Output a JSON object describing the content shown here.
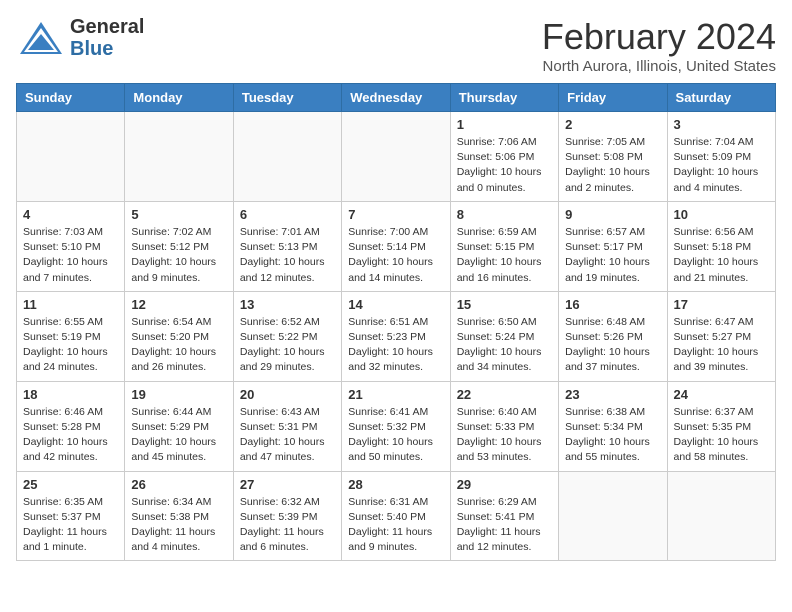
{
  "header": {
    "logo_general": "General",
    "logo_blue": "Blue",
    "month_year": "February 2024",
    "location": "North Aurora, Illinois, United States"
  },
  "weekdays": [
    "Sunday",
    "Monday",
    "Tuesday",
    "Wednesday",
    "Thursday",
    "Friday",
    "Saturday"
  ],
  "weeks": [
    [
      {
        "day": "",
        "info": ""
      },
      {
        "day": "",
        "info": ""
      },
      {
        "day": "",
        "info": ""
      },
      {
        "day": "",
        "info": ""
      },
      {
        "day": "1",
        "info": "Sunrise: 7:06 AM\nSunset: 5:06 PM\nDaylight: 10 hours\nand 0 minutes."
      },
      {
        "day": "2",
        "info": "Sunrise: 7:05 AM\nSunset: 5:08 PM\nDaylight: 10 hours\nand 2 minutes."
      },
      {
        "day": "3",
        "info": "Sunrise: 7:04 AM\nSunset: 5:09 PM\nDaylight: 10 hours\nand 4 minutes."
      }
    ],
    [
      {
        "day": "4",
        "info": "Sunrise: 7:03 AM\nSunset: 5:10 PM\nDaylight: 10 hours\nand 7 minutes."
      },
      {
        "day": "5",
        "info": "Sunrise: 7:02 AM\nSunset: 5:12 PM\nDaylight: 10 hours\nand 9 minutes."
      },
      {
        "day": "6",
        "info": "Sunrise: 7:01 AM\nSunset: 5:13 PM\nDaylight: 10 hours\nand 12 minutes."
      },
      {
        "day": "7",
        "info": "Sunrise: 7:00 AM\nSunset: 5:14 PM\nDaylight: 10 hours\nand 14 minutes."
      },
      {
        "day": "8",
        "info": "Sunrise: 6:59 AM\nSunset: 5:15 PM\nDaylight: 10 hours\nand 16 minutes."
      },
      {
        "day": "9",
        "info": "Sunrise: 6:57 AM\nSunset: 5:17 PM\nDaylight: 10 hours\nand 19 minutes."
      },
      {
        "day": "10",
        "info": "Sunrise: 6:56 AM\nSunset: 5:18 PM\nDaylight: 10 hours\nand 21 minutes."
      }
    ],
    [
      {
        "day": "11",
        "info": "Sunrise: 6:55 AM\nSunset: 5:19 PM\nDaylight: 10 hours\nand 24 minutes."
      },
      {
        "day": "12",
        "info": "Sunrise: 6:54 AM\nSunset: 5:20 PM\nDaylight: 10 hours\nand 26 minutes."
      },
      {
        "day": "13",
        "info": "Sunrise: 6:52 AM\nSunset: 5:22 PM\nDaylight: 10 hours\nand 29 minutes."
      },
      {
        "day": "14",
        "info": "Sunrise: 6:51 AM\nSunset: 5:23 PM\nDaylight: 10 hours\nand 32 minutes."
      },
      {
        "day": "15",
        "info": "Sunrise: 6:50 AM\nSunset: 5:24 PM\nDaylight: 10 hours\nand 34 minutes."
      },
      {
        "day": "16",
        "info": "Sunrise: 6:48 AM\nSunset: 5:26 PM\nDaylight: 10 hours\nand 37 minutes."
      },
      {
        "day": "17",
        "info": "Sunrise: 6:47 AM\nSunset: 5:27 PM\nDaylight: 10 hours\nand 39 minutes."
      }
    ],
    [
      {
        "day": "18",
        "info": "Sunrise: 6:46 AM\nSunset: 5:28 PM\nDaylight: 10 hours\nand 42 minutes."
      },
      {
        "day": "19",
        "info": "Sunrise: 6:44 AM\nSunset: 5:29 PM\nDaylight: 10 hours\nand 45 minutes."
      },
      {
        "day": "20",
        "info": "Sunrise: 6:43 AM\nSunset: 5:31 PM\nDaylight: 10 hours\nand 47 minutes."
      },
      {
        "day": "21",
        "info": "Sunrise: 6:41 AM\nSunset: 5:32 PM\nDaylight: 10 hours\nand 50 minutes."
      },
      {
        "day": "22",
        "info": "Sunrise: 6:40 AM\nSunset: 5:33 PM\nDaylight: 10 hours\nand 53 minutes."
      },
      {
        "day": "23",
        "info": "Sunrise: 6:38 AM\nSunset: 5:34 PM\nDaylight: 10 hours\nand 55 minutes."
      },
      {
        "day": "24",
        "info": "Sunrise: 6:37 AM\nSunset: 5:35 PM\nDaylight: 10 hours\nand 58 minutes."
      }
    ],
    [
      {
        "day": "25",
        "info": "Sunrise: 6:35 AM\nSunset: 5:37 PM\nDaylight: 11 hours\nand 1 minute."
      },
      {
        "day": "26",
        "info": "Sunrise: 6:34 AM\nSunset: 5:38 PM\nDaylight: 11 hours\nand 4 minutes."
      },
      {
        "day": "27",
        "info": "Sunrise: 6:32 AM\nSunset: 5:39 PM\nDaylight: 11 hours\nand 6 minutes."
      },
      {
        "day": "28",
        "info": "Sunrise: 6:31 AM\nSunset: 5:40 PM\nDaylight: 11 hours\nand 9 minutes."
      },
      {
        "day": "29",
        "info": "Sunrise: 6:29 AM\nSunset: 5:41 PM\nDaylight: 11 hours\nand 12 minutes."
      },
      {
        "day": "",
        "info": ""
      },
      {
        "day": "",
        "info": ""
      }
    ]
  ]
}
